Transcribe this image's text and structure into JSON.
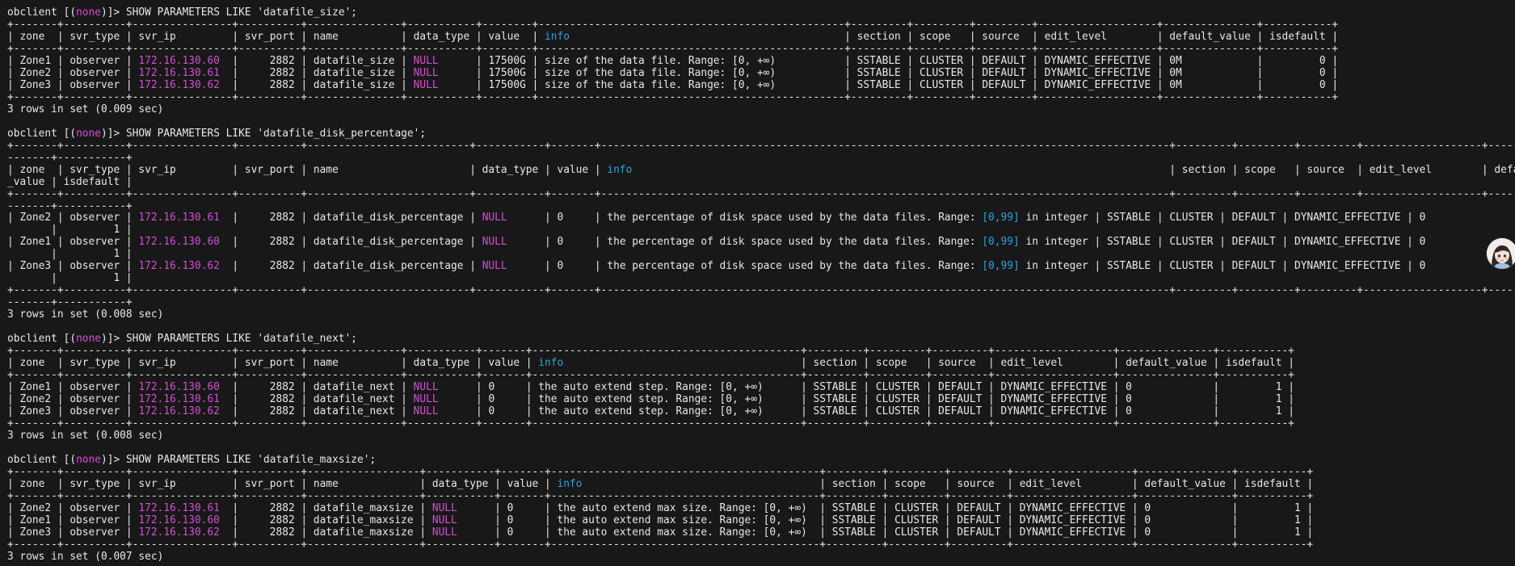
{
  "colors": {
    "background": "#181818",
    "text": "#e8e8e8",
    "null_keyword": "#d24fd3",
    "ip_address": "#d24fd3",
    "info_header": "#2ea3d9",
    "range_value": "#2ea3d9"
  },
  "prompt": {
    "open": "obclient [(",
    "database": "none",
    "close": ")]> "
  },
  "commands": [
    {
      "command": "SHOW PARAMETERS LIKE 'datafile_size';",
      "borders": [
        "+-------+----------+----------------+----------+---------------+-----------+--------+-------------------------------------------------+---------+---------+---------+-------------------+---------------+-----------+",
        "+-------+----------+----------------+----------+---------------+-----------+--------+-------------------------------------------------+---------+---------+---------+-------------------+---------------+-----------+",
        "+-------+----------+----------------+----------+---------------+-----------+--------+-------------------------------------------------+---------+---------+---------+-------------------+---------------+-----------+"
      ],
      "header": [
        [
          {
            "t": "| zone  | svr_type | svr_ip         | svr_port | name          | data_type | value  | "
          },
          {
            "t": "info",
            "c": "info"
          },
          {
            "t": "                                            | section | scope   | source  | edit_level        | default_value | isdefault |"
          }
        ]
      ],
      "rows": [
        [
          [
            {
              "t": "| Zone1 | observer | "
            },
            {
              "t": "172.16.130.60",
              "c": "ip"
            },
            {
              "t": "  |     2882 | datafile_size | "
            },
            {
              "t": "NULL",
              "c": "null"
            },
            {
              "t": "      | 17500G | size of the data file. Range: [0, +∞)           | SSTABLE | CLUSTER | DEFAULT | DYNAMIC_EFFECTIVE | 0M            |         0 |"
            }
          ]
        ],
        [
          [
            {
              "t": "| Zone2 | observer | "
            },
            {
              "t": "172.16.130.61",
              "c": "ip"
            },
            {
              "t": "  |     2882 | datafile_size | "
            },
            {
              "t": "NULL",
              "c": "null"
            },
            {
              "t": "      | 17500G | size of the data file. Range: [0, +∞)           | SSTABLE | CLUSTER | DEFAULT | DYNAMIC_EFFECTIVE | 0M            |         0 |"
            }
          ]
        ],
        [
          [
            {
              "t": "| Zone3 | observer | "
            },
            {
              "t": "172.16.130.62",
              "c": "ip"
            },
            {
              "t": "  |     2882 | datafile_size | "
            },
            {
              "t": "NULL",
              "c": "null"
            },
            {
              "t": "      | 17500G | size of the data file. Range: [0, +∞)           | SSTABLE | CLUSTER | DEFAULT | DYNAMIC_EFFECTIVE | 0M            |         0 |"
            }
          ]
        ]
      ],
      "footer": "3 rows in set (0.009 sec)"
    },
    {
      "command": "SHOW PARAMETERS LIKE 'datafile_disk_percentage';",
      "borders": [
        "+-------+----------+----------------+----------+--------------------------+-----------+-------+-------------------------------------------------------------------------------------------+---------+---------+---------+-------------------+--------\n-------+-----------+",
        "+-------+----------+----------------+----------+--------------------------+-----------+-------+-------------------------------------------------------------------------------------------+---------+---------+---------+-------------------+--------\n-------+-----------+",
        "+-------+----------+----------------+----------+--------------------------+-----------+-------+-------------------------------------------------------------------------------------------+---------+---------+---------+-------------------+--------\n-------+-----------+"
      ],
      "header": [
        [
          {
            "t": "| zone  | svr_type | svr_ip         | svr_port | name                     | data_type | value | "
          },
          {
            "t": "info",
            "c": "info"
          },
          {
            "t": "                                                                                      | section | scope   | source  | edit_level        | default"
          }
        ],
        [
          {
            "t": "_value | isdefault |"
          }
        ]
      ],
      "rows": [
        [
          [
            {
              "t": "| Zone2 | observer | "
            },
            {
              "t": "172.16.130.61",
              "c": "ip"
            },
            {
              "t": "  |     2882 | datafile_disk_percentage | "
            },
            {
              "t": "NULL",
              "c": "null"
            },
            {
              "t": "      | 0     | the percentage of disk space used by the data files. Range: "
            },
            {
              "t": "[0,99]",
              "c": "range"
            },
            {
              "t": " in integer | SSTABLE | CLUSTER | DEFAULT | DYNAMIC_EFFECTIVE | 0"
            }
          ],
          [
            {
              "t": "       |         1 |"
            }
          ]
        ],
        [
          [
            {
              "t": "| Zone1 | observer | "
            },
            {
              "t": "172.16.130.60",
              "c": "ip"
            },
            {
              "t": "  |     2882 | datafile_disk_percentage | "
            },
            {
              "t": "NULL",
              "c": "null"
            },
            {
              "t": "      | 0     | the percentage of disk space used by the data files. Range: "
            },
            {
              "t": "[0,99]",
              "c": "range"
            },
            {
              "t": " in integer | SSTABLE | CLUSTER | DEFAULT | DYNAMIC_EFFECTIVE | 0"
            }
          ],
          [
            {
              "t": "       |         1 |"
            }
          ]
        ],
        [
          [
            {
              "t": "| Zone3 | observer | "
            },
            {
              "t": "172.16.130.62",
              "c": "ip"
            },
            {
              "t": "  |     2882 | datafile_disk_percentage | "
            },
            {
              "t": "NULL",
              "c": "null"
            },
            {
              "t": "      | 0     | the percentage of disk space used by the data files. Range: "
            },
            {
              "t": "[0,99]",
              "c": "range"
            },
            {
              "t": " in integer | SSTABLE | CLUSTER | DEFAULT | DYNAMIC_EFFECTIVE | 0"
            }
          ],
          [
            {
              "t": "       |         1 |"
            }
          ]
        ]
      ],
      "footer": "3 rows in set (0.008 sec)"
    },
    {
      "command": "SHOW PARAMETERS LIKE 'datafile_next';",
      "borders": [
        "+-------+----------+----------------+----------+---------------+-----------+-------+-------------------------------------------+---------+---------+---------+-------------------+---------------+-----------+",
        "+-------+----------+----------------+----------+---------------+-----------+-------+-------------------------------------------+---------+---------+---------+-------------------+---------------+-----------+",
        "+-------+----------+----------------+----------+---------------+-----------+-------+-------------------------------------------+---------+---------+---------+-------------------+---------------+-----------+"
      ],
      "header": [
        [
          {
            "t": "| zone  | svr_type | svr_ip         | svr_port | name          | data_type | value | "
          },
          {
            "t": "info",
            "c": "info"
          },
          {
            "t": "                                      | section | scope   | source  | edit_level        | default_value | isdefault |"
          }
        ]
      ],
      "rows": [
        [
          [
            {
              "t": "| Zone1 | observer | "
            },
            {
              "t": "172.16.130.60",
              "c": "ip"
            },
            {
              "t": "  |     2882 | datafile_next | "
            },
            {
              "t": "NULL",
              "c": "null"
            },
            {
              "t": "      | 0     | the auto extend step. Range: [0, +∞)      | SSTABLE | CLUSTER | DEFAULT | DYNAMIC_EFFECTIVE | 0             |         1 |"
            }
          ]
        ],
        [
          [
            {
              "t": "| Zone2 | observer | "
            },
            {
              "t": "172.16.130.61",
              "c": "ip"
            },
            {
              "t": "  |     2882 | datafile_next | "
            },
            {
              "t": "NULL",
              "c": "null"
            },
            {
              "t": "      | 0     | the auto extend step. Range: [0, +∞)      | SSTABLE | CLUSTER | DEFAULT | DYNAMIC_EFFECTIVE | 0             |         1 |"
            }
          ]
        ],
        [
          [
            {
              "t": "| Zone3 | observer | "
            },
            {
              "t": "172.16.130.62",
              "c": "ip"
            },
            {
              "t": "  |     2882 | datafile_next | "
            },
            {
              "t": "NULL",
              "c": "null"
            },
            {
              "t": "      | 0     | the auto extend step. Range: [0, +∞)      | SSTABLE | CLUSTER | DEFAULT | DYNAMIC_EFFECTIVE | 0             |         1 |"
            }
          ]
        ]
      ],
      "footer": "3 rows in set (0.008 sec)"
    },
    {
      "command": "SHOW PARAMETERS LIKE 'datafile_maxsize';",
      "borders": [
        "+-------+----------+----------------+----------+------------------+-----------+-------+-------------------------------------------+---------+---------+---------+-------------------+---------------+-----------+",
        "+-------+----------+----------------+----------+------------------+-----------+-------+-------------------------------------------+---------+---------+---------+-------------------+---------------+-----------+",
        "+-------+----------+----------------+----------+------------------+-----------+-------+-------------------------------------------+---------+---------+---------+-------------------+---------------+-----------+"
      ],
      "header": [
        [
          {
            "t": "| zone  | svr_type | svr_ip         | svr_port | name             | data_type | value | "
          },
          {
            "t": "info",
            "c": "info"
          },
          {
            "t": "                                      | section | scope   | source  | edit_level        | default_value | isdefault |"
          }
        ]
      ],
      "rows": [
        [
          [
            {
              "t": "| Zone2 | observer | "
            },
            {
              "t": "172.16.130.61",
              "c": "ip"
            },
            {
              "t": "  |     2882 | datafile_maxsize | "
            },
            {
              "t": "NULL",
              "c": "null"
            },
            {
              "t": "      | 0     | the auto extend max size. Range: [0, +∞)  | SSTABLE | CLUSTER | DEFAULT | DYNAMIC_EFFECTIVE | 0             |         1 |"
            }
          ]
        ],
        [
          [
            {
              "t": "| Zone1 | observer | "
            },
            {
              "t": "172.16.130.60",
              "c": "ip"
            },
            {
              "t": "  |     2882 | datafile_maxsize | "
            },
            {
              "t": "NULL",
              "c": "null"
            },
            {
              "t": "      | 0     | the auto extend max size. Range: [0, +∞)  | SSTABLE | CLUSTER | DEFAULT | DYNAMIC_EFFECTIVE | 0             |         1 |"
            }
          ]
        ],
        [
          [
            {
              "t": "| Zone3 | observer | "
            },
            {
              "t": "172.16.130.62",
              "c": "ip"
            },
            {
              "t": "  |     2882 | datafile_maxsize | "
            },
            {
              "t": "NULL",
              "c": "null"
            },
            {
              "t": "      | 0     | the auto extend max size. Range: [0, +∞)  | SSTABLE | CLUSTER | DEFAULT | DYNAMIC_EFFECTIVE | 0             |         1 |"
            }
          ]
        ]
      ],
      "footer": "3 rows in set (0.007 sec)"
    }
  ],
  "avatar": {
    "icon": "girl-avatar-icon"
  }
}
